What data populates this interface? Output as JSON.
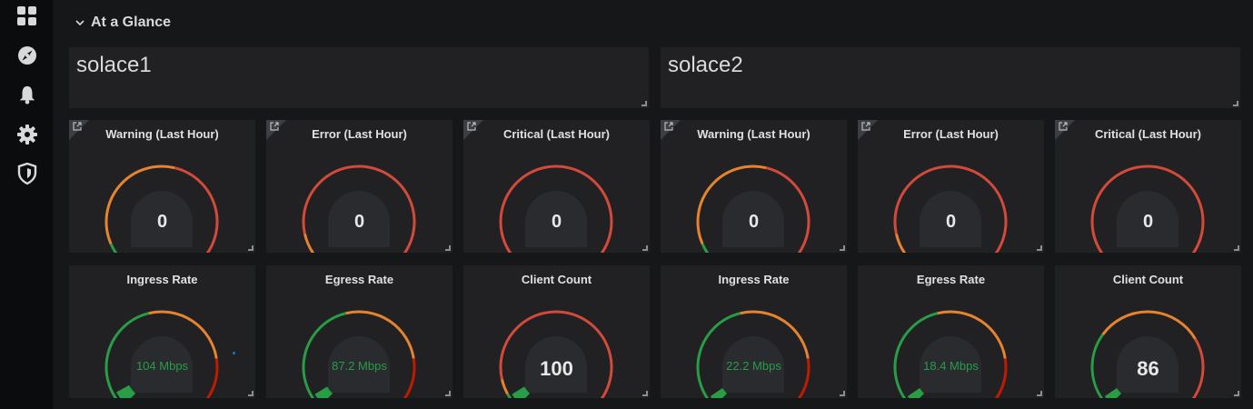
{
  "sidebar": {
    "icons": [
      "dashboards-icon",
      "explore-icon",
      "alerting-icon",
      "configuration-icon",
      "shield-icon"
    ]
  },
  "row": {
    "title": "At a Glance"
  },
  "servers": [
    {
      "name": "solace1"
    },
    {
      "name": "solace2"
    }
  ],
  "alert_panels": [
    {
      "title": "Warning (Last Hour)",
      "value": "0",
      "level": 0
    },
    {
      "title": "Error (Last Hour)",
      "value": "0",
      "level": 0
    },
    {
      "title": "Critical (Last Hour)",
      "value": "0",
      "level": 0
    },
    {
      "title": "Warning (Last Hour)",
      "value": "0",
      "level": 0
    },
    {
      "title": "Error (Last Hour)",
      "value": "0",
      "level": 0
    },
    {
      "title": "Critical (Last Hour)",
      "value": "0",
      "level": 0
    }
  ],
  "rate_panels": [
    {
      "title": "Ingress Rate",
      "value": "104 Mbps",
      "level": 0.06
    },
    {
      "title": "Egress Rate",
      "value": "87.2 Mbps",
      "level": 0.05
    },
    {
      "title": "Client Count",
      "value": "100",
      "level": 0.05
    },
    {
      "title": "Ingress Rate",
      "value": "22.2 Mbps",
      "level": 0.04
    },
    {
      "title": "Egress Rate",
      "value": "18.4 Mbps",
      "level": 0.04
    },
    {
      "title": "Client Count",
      "value": "86",
      "level": 0.04
    }
  ],
  "colors": {
    "green": "#299c46",
    "orange": "#e5832f",
    "red": "#d44a3a",
    "dark_red": "#bf1b00",
    "value_white": "#e8e8e8"
  }
}
